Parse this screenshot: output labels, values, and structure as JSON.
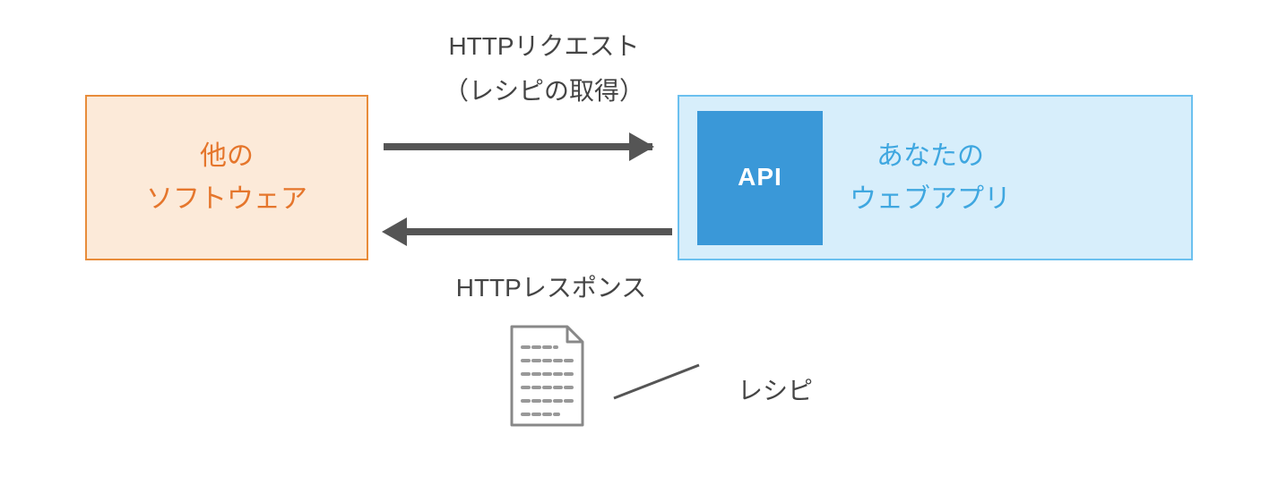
{
  "diagram": {
    "left_box": {
      "line1": "他の",
      "line2": "ソフトウェア"
    },
    "right_box": {
      "api_label": "API",
      "line1": "あなたの",
      "line2": "ウェブアプリ"
    },
    "labels": {
      "request_line1": "HTTPリクエスト",
      "request_line2": "（レシピの取得）",
      "response": "HTTPレスポンス",
      "recipe": "レシピ"
    }
  }
}
